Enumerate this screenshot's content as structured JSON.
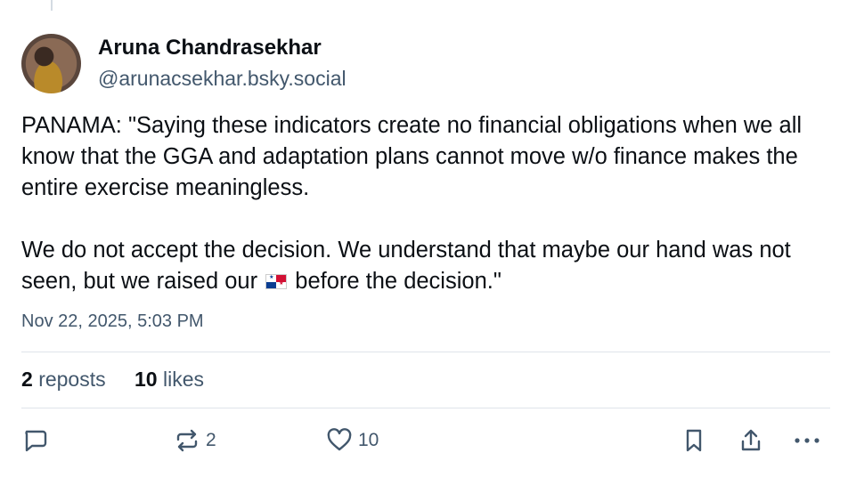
{
  "post": {
    "author_name": "Aruna Chandrasekhar",
    "author_handle": "@arunacsekhar.bsky.social",
    "text_before_flag": "PANAMA: \"Saying these indicators create no financial obligations when we all know that the GGA and adaptation plans cannot move w/o finance makes the entire exercise meaningless.\n\nWe do not accept the decision. We understand that maybe our hand was not seen, but we raised our",
    "flag_emoji": "panama-flag-icon",
    "text_after_flag": "before the decision.\"",
    "timestamp": "Nov 22, 2025, 5:03 PM"
  },
  "stats": {
    "reposts_count": "2",
    "reposts_label": "reposts",
    "likes_count": "10",
    "likes_label": "likes"
  },
  "actions": {
    "reply_icon": "reply-icon",
    "repost_icon": "repost-icon",
    "repost_count": "2",
    "like_icon": "heart-icon",
    "like_count": "10",
    "bookmark_icon": "bookmark-icon",
    "share_icon": "share-icon",
    "more_icon": "more-icon"
  },
  "colors": {
    "text": "#0b0f14",
    "muted": "#42576c",
    "divider": "#dfe4ea"
  }
}
